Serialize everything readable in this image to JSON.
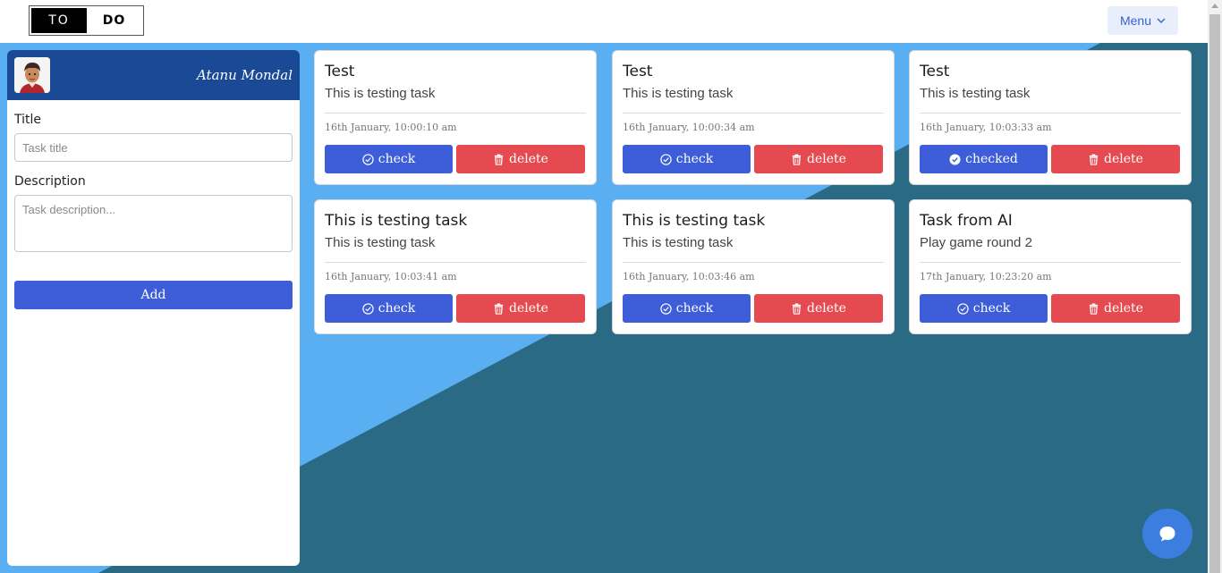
{
  "header": {
    "logo_left": "TO",
    "logo_right": "DO",
    "menu_label": "Menu"
  },
  "sidebar": {
    "username": "Atanu Mondal",
    "title_label": "Title",
    "title_placeholder": "Task title",
    "description_label": "Description",
    "description_placeholder": "Task description...",
    "add_label": "Add"
  },
  "tasks": [
    {
      "title": "Test",
      "description": "This is testing task",
      "date": "16th January, 10:00:10 am",
      "check_label": "check",
      "delete_label": "delete",
      "checked": false
    },
    {
      "title": "Test",
      "description": "This is testing task",
      "date": "16th January, 10:00:34 am",
      "check_label": "check",
      "delete_label": "delete",
      "checked": false
    },
    {
      "title": "Test",
      "description": "This is testing task",
      "date": "16th January, 10:03:33 am",
      "check_label": "checked",
      "delete_label": "delete",
      "checked": true
    },
    {
      "title": "This is testing task",
      "description": "This is testing task",
      "date": "16th January, 10:03:41 am",
      "check_label": "check",
      "delete_label": "delete",
      "checked": false
    },
    {
      "title": "This is testing task",
      "description": "This is testing task",
      "date": "16th January, 10:03:46 am",
      "check_label": "check",
      "delete_label": "delete",
      "checked": false
    },
    {
      "title": "Task from AI",
      "description": "Play game round 2",
      "date": "17th January, 10:23:20 am",
      "check_label": "check",
      "delete_label": "delete",
      "checked": false
    }
  ],
  "icons": {
    "menu": "chevron-down-icon",
    "check": "check-circle-icon",
    "checked": "check-circle-filled-icon",
    "delete": "trash-icon",
    "chat": "chat-bubble-icon"
  },
  "colors": {
    "primary": "#3d5ed8",
    "danger": "#e44a4f",
    "profile_bar": "#1a4a96",
    "bg_light": "#5aaef2",
    "bg_dark": "#2b6a84"
  }
}
